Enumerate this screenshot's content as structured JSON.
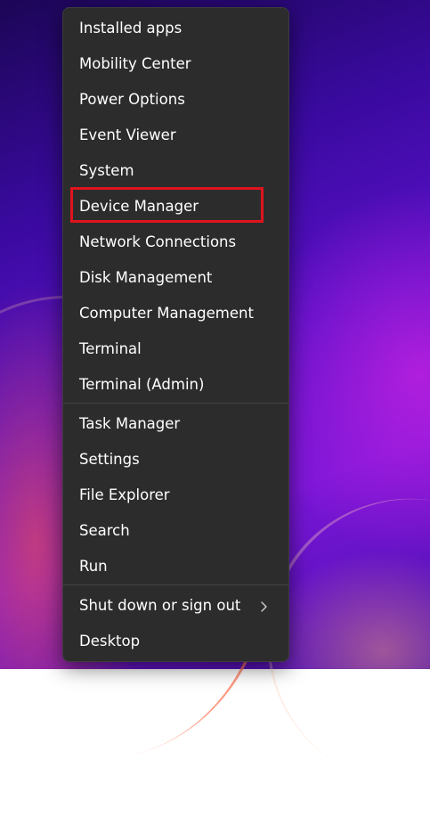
{
  "menu": {
    "items": [
      {
        "label": "Installed apps"
      },
      {
        "label": "Mobility Center"
      },
      {
        "label": "Power Options"
      },
      {
        "label": "Event Viewer"
      },
      {
        "label": "System"
      },
      {
        "label": "Device Manager"
      },
      {
        "label": "Network Connections"
      },
      {
        "label": "Disk Management"
      },
      {
        "label": "Computer Management"
      },
      {
        "label": "Terminal"
      },
      {
        "label": "Terminal (Admin)"
      },
      {
        "label": "Task Manager"
      },
      {
        "label": "Settings"
      },
      {
        "label": "File Explorer"
      },
      {
        "label": "Search"
      },
      {
        "label": "Run"
      },
      {
        "label": "Shut down or sign out",
        "submenu_icon": "chevron-right-icon"
      },
      {
        "label": "Desktop"
      }
    ],
    "highlighted_item": "Device Manager",
    "highlight_color": "#e0141e",
    "background_color": "#2c2c2c",
    "text_color": "#ffffff"
  }
}
